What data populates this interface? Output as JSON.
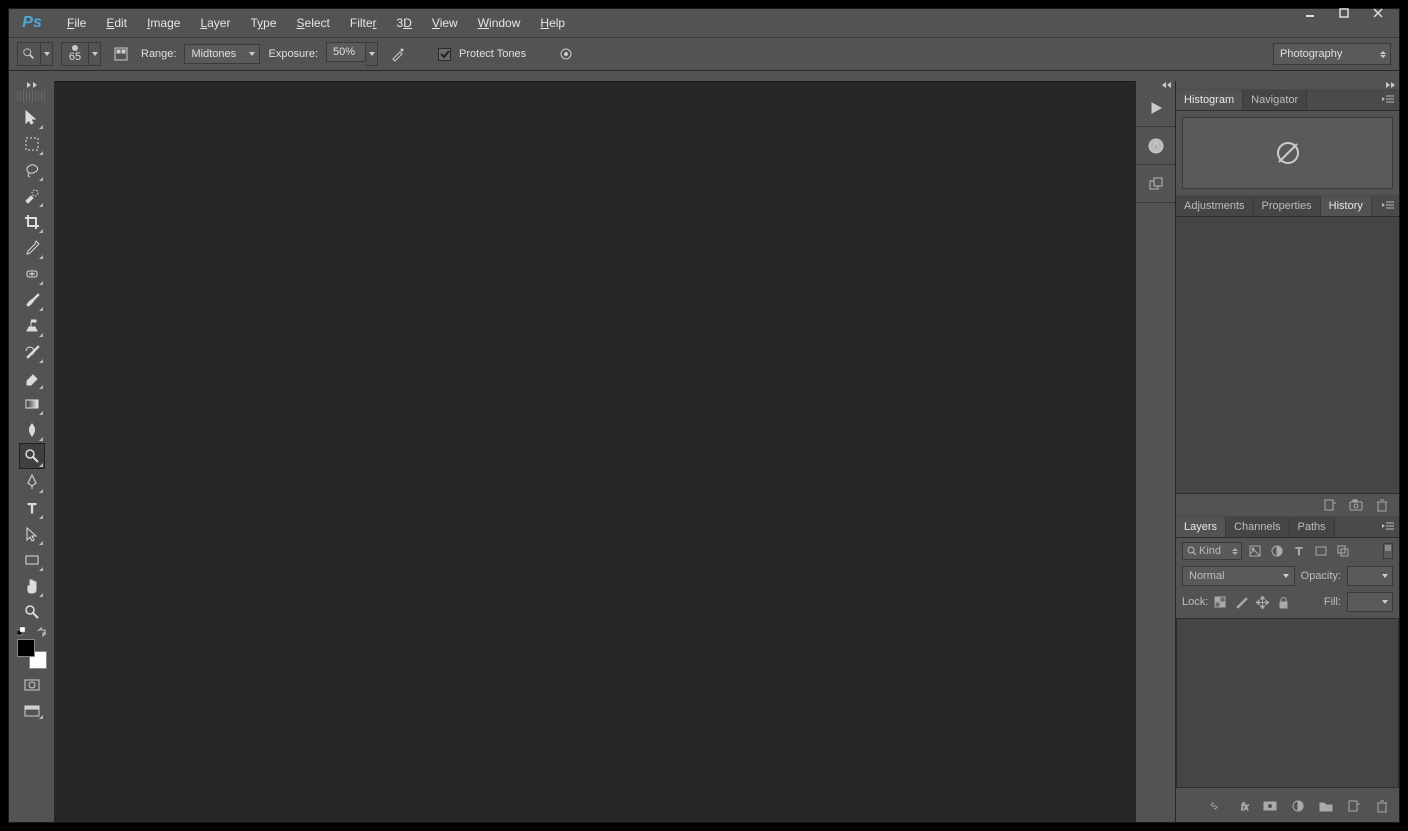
{
  "menubar": {
    "items": [
      "File",
      "Edit",
      "Image",
      "Layer",
      "Type",
      "Select",
      "Filter",
      "3D",
      "View",
      "Window",
      "Help"
    ]
  },
  "options": {
    "brush_size": "65",
    "range_label": "Range:",
    "range_value": "Midtones",
    "exposure_label": "Exposure:",
    "exposure_value": "50%",
    "protect_tones_label": "Protect Tones",
    "workspace": "Photography"
  },
  "panels": {
    "group1_tabs": [
      "Histogram",
      "Navigator"
    ],
    "group1_active": "Histogram",
    "group2_tabs": [
      "Adjustments",
      "Properties",
      "History"
    ],
    "group2_active": "History",
    "group3_tabs": [
      "Layers",
      "Channels",
      "Paths"
    ],
    "group3_active": "Layers"
  },
  "layers": {
    "kind_label": "Kind",
    "blend_mode": "Normal",
    "opacity_label": "Opacity:",
    "opacity_value": "",
    "lock_label": "Lock:",
    "fill_label": "Fill:",
    "fill_value": ""
  },
  "tools": [
    "move-tool",
    "marquee-tool",
    "lasso-tool",
    "quick-select-tool",
    "crop-tool",
    "eyedropper-tool",
    "spot-heal-tool",
    "brush-tool",
    "clone-stamp-tool",
    "history-brush-tool",
    "eraser-tool",
    "gradient-tool",
    "blur-tool",
    "dodge-tool",
    "pen-tool",
    "type-tool",
    "path-select-tool",
    "rectangle-tool",
    "hand-tool",
    "zoom-tool"
  ],
  "selected_tool": "dodge-tool"
}
